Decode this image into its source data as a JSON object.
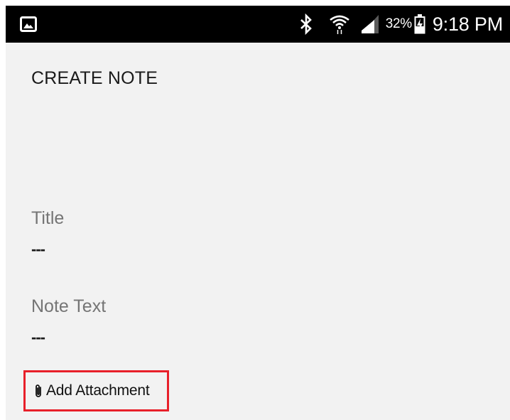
{
  "status_bar": {
    "left_icon": "gallery-icon",
    "icons": [
      "bluetooth-icon",
      "wifi-icon",
      "signal-icon",
      "battery-icon"
    ],
    "battery_percent": "32%",
    "time": "9:18 PM"
  },
  "page": {
    "title": "CREATE NOTE"
  },
  "form": {
    "title_label": "Title",
    "title_value": "---",
    "note_label": "Note Text",
    "note_value": "---"
  },
  "attachment": {
    "icon": "paperclip-icon",
    "label": "Add Attachment",
    "highlight_color": "#e8202a"
  }
}
